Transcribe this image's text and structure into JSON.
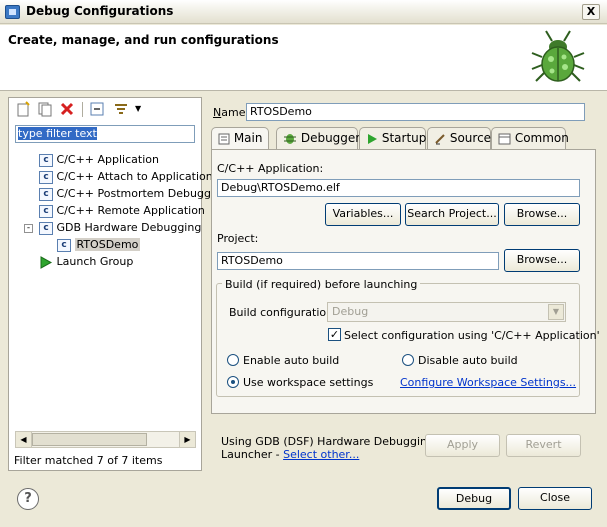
{
  "window": {
    "title": "Debug Configurations",
    "close_label": "X"
  },
  "header": {
    "title": "Create, manage, and run configurations",
    "banner_icon": "bug-icon"
  },
  "left": {
    "toolbar_icons": [
      "new-config-icon",
      "duplicate-icon",
      "delete-icon",
      "collapse-all-icon",
      "filter-icon",
      "view-menu-icon"
    ],
    "filter_value": "type filter text",
    "tree": [
      {
        "label": "C/C++ Application",
        "icon": "c-app-icon",
        "level": 1
      },
      {
        "label": "C/C++ Attach to Application",
        "icon": "c-app-icon",
        "level": 1
      },
      {
        "label": "C/C++ Postmortem Debugge",
        "icon": "c-app-icon",
        "level": 1
      },
      {
        "label": "C/C++ Remote Application",
        "icon": "c-app-icon",
        "level": 1
      },
      {
        "label": "GDB Hardware Debugging",
        "icon": "c-app-icon",
        "level": 1,
        "expanded": true
      },
      {
        "label": "RTOSDemo",
        "icon": "c-app-icon",
        "level": 2,
        "selected": true
      },
      {
        "label": "Launch Group",
        "icon": "launch-group-icon",
        "level": 1
      }
    ],
    "status": "Filter matched 7 of 7 items"
  },
  "right": {
    "name_label": "Name:",
    "name_value": "RTOSDemo",
    "tabs": [
      "Main",
      "Debugger",
      "Startup",
      "Source",
      "Common"
    ],
    "active_tab": "Main",
    "app_label": "C/C++ Application:",
    "app_value": "Debug\\RTOSDemo.elf",
    "variables_btn": "Variables...",
    "search_btn": "Search Project...",
    "browse_btn1": "Browse...",
    "project_label": "Project:",
    "project_value": "RTOSDemo",
    "browse_btn2": "Browse...",
    "build_group": "Build (if required) before launching",
    "build_config_label": "Build configuration:",
    "build_config_value": "Debug",
    "select_config_label": "Select configuration using 'C/C++ Application'",
    "select_config_checked": true,
    "enable_auto": "Enable auto build",
    "disable_auto": "Disable auto build",
    "use_workspace": "Use workspace settings",
    "workspace_selected": true,
    "configure_link": "Configure Workspace Settings...",
    "launcher_line1": "Using GDB (DSF) Hardware Debugging",
    "launcher_line2": "Launcher - ",
    "select_other": "Select other...",
    "apply_btn": "Apply",
    "revert_btn": "Revert"
  },
  "footer": {
    "help": "?",
    "debug_btn": "Debug",
    "close_btn": "Close"
  }
}
